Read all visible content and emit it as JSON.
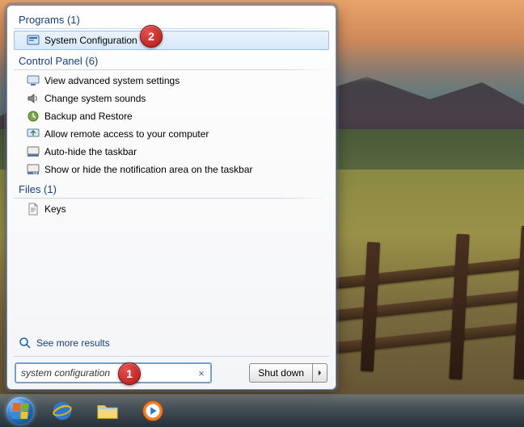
{
  "groups": {
    "programs": {
      "header": "Programs (1)",
      "items": [
        "System Configuration"
      ]
    },
    "control": {
      "header": "Control Panel (6)",
      "items": [
        "View advanced system settings",
        "Change system sounds",
        "Backup and Restore",
        "Allow remote access to your computer",
        "Auto-hide the taskbar",
        "Show or hide the notification area on the taskbar"
      ]
    },
    "files": {
      "header": "Files (1)",
      "items": [
        "Keys"
      ]
    }
  },
  "more_results": "See more results",
  "search": {
    "value": "system configuration",
    "clear_glyph": "×"
  },
  "shutdown": {
    "label": "Shut down"
  },
  "callouts": {
    "step1": "1",
    "step2": "2"
  },
  "colors": {
    "header_link": "#1a3e7a",
    "selection_border": "#9dc1e8",
    "badge": "#c62828"
  },
  "taskbar": {
    "icons": [
      "start-orb",
      "internet-explorer",
      "file-explorer",
      "windows-media-player"
    ]
  }
}
